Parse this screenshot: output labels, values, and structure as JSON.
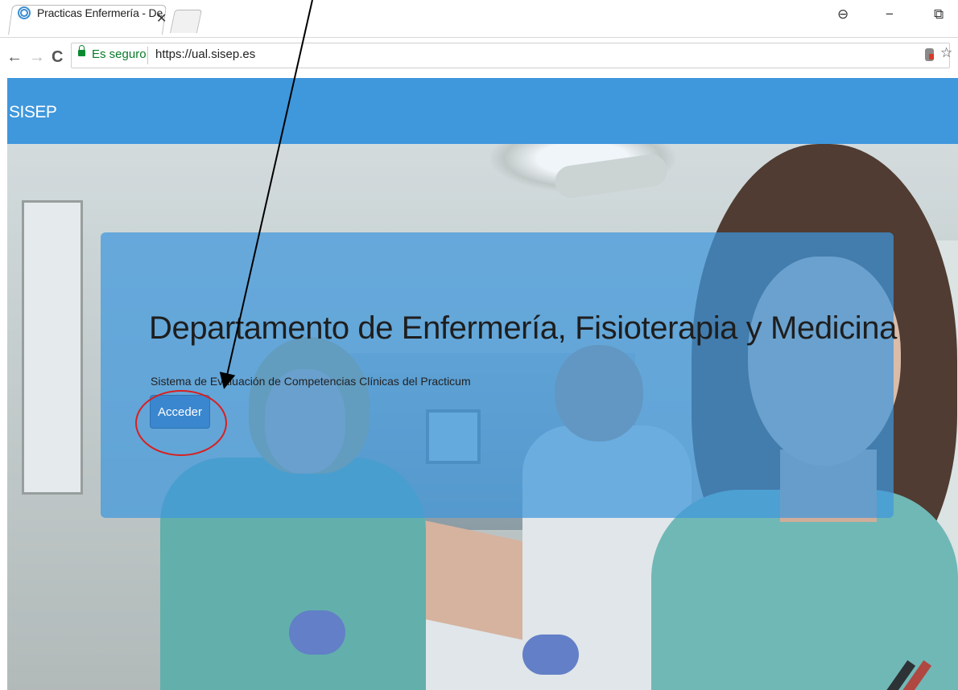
{
  "browser": {
    "tab_title": "Practicas Enfermería - De",
    "tab_close": "✕",
    "window_controls": {
      "account": "⊖",
      "minimize": "−",
      "restore": "⧉"
    },
    "security_label": "Es seguro",
    "url": "https://ual.sisep.es",
    "nav": {
      "back": "←",
      "forward": "→",
      "reload": "C"
    },
    "bookmark_star": "☆",
    "icons": [
      "favicon",
      "lock-icon",
      "extension-icon",
      "bookmark-star-icon"
    ]
  },
  "site": {
    "brand": "SISEP",
    "header_color": "#3f97dc"
  },
  "hero": {
    "headline": "Departamento de Enfermería, Fisioterapia y Medicina",
    "subtitle": "Sistema de Evaluación de Competencias Clínicas del Practicum",
    "button_label": "Acceder",
    "panel_color": "#3f97dc",
    "background_image": "hospital-staff-photo"
  },
  "annotations": {
    "arrow_color": "#000000",
    "circle_color": "#d91f1f",
    "marks": [
      "pointer-arrow",
      "highlight-circle"
    ]
  }
}
